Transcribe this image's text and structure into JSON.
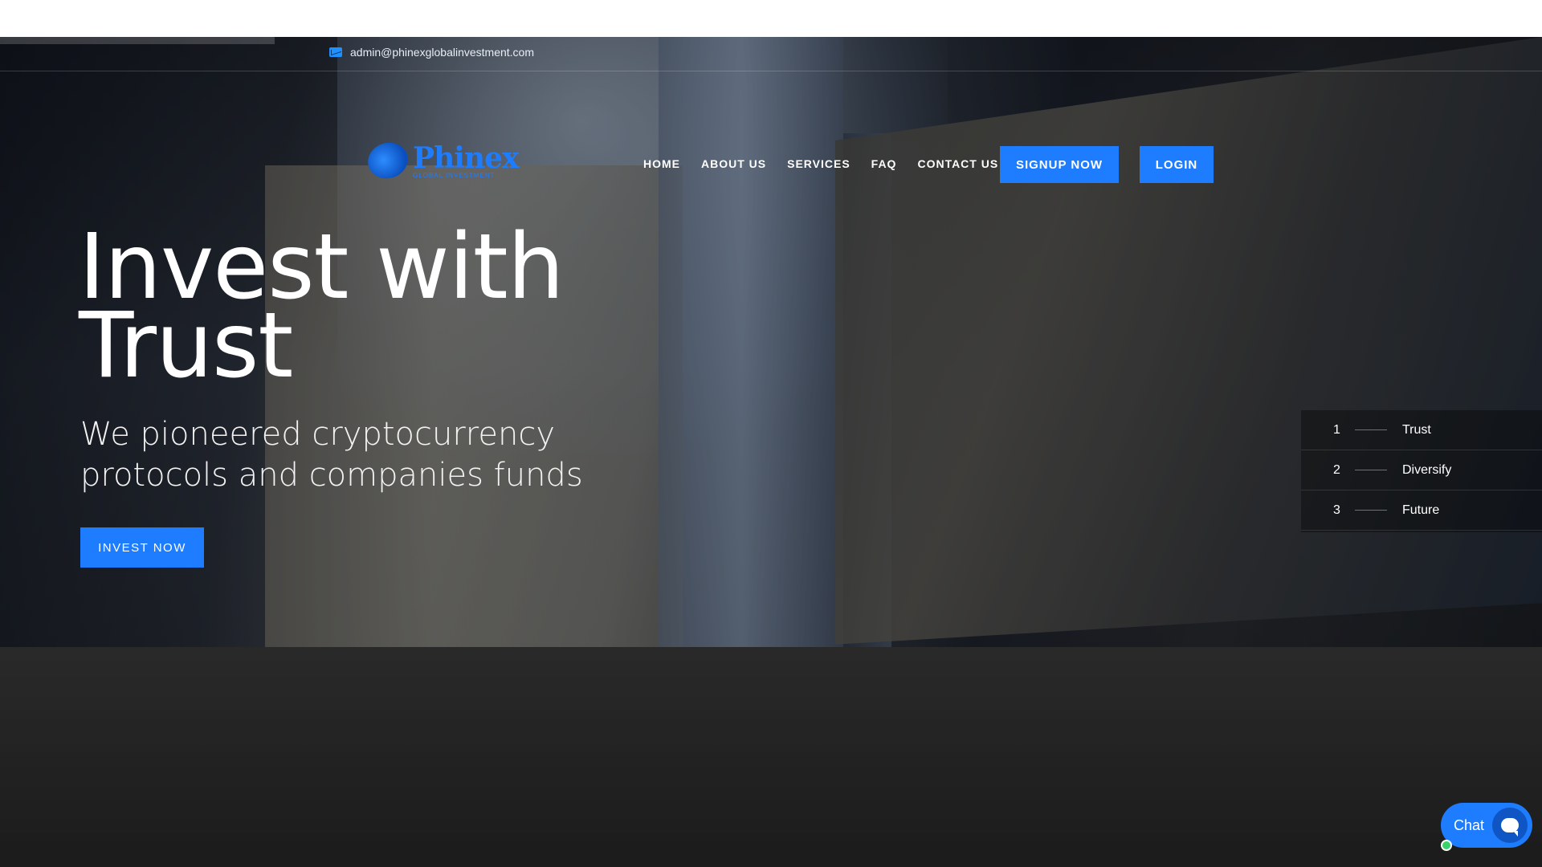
{
  "topbar": {
    "email": "admin@phinexglobalinvestment.com"
  },
  "logo": {
    "name": "Phinex",
    "tagline": "GLOBAL INVESTMENT"
  },
  "nav": {
    "items": [
      "HOME",
      "ABOUT US",
      "SERVICES",
      "FAQ",
      "CONTACT US"
    ],
    "signup_label": "SIGNUP NOW",
    "login_label": "LOGIN"
  },
  "hero": {
    "title": "Invest with Trust",
    "subtitle": "We pioneered cryptocurrency protocols and companies funds",
    "cta_label": "INVEST NOW"
  },
  "slider": {
    "items": [
      {
        "num": "1",
        "label": "Trust"
      },
      {
        "num": "2",
        "label": "Diversify"
      },
      {
        "num": "3",
        "label": "Future"
      }
    ]
  },
  "chat": {
    "label": "Chat"
  },
  "colors": {
    "accent": "#1e7cff",
    "online": "#3ad36b"
  }
}
